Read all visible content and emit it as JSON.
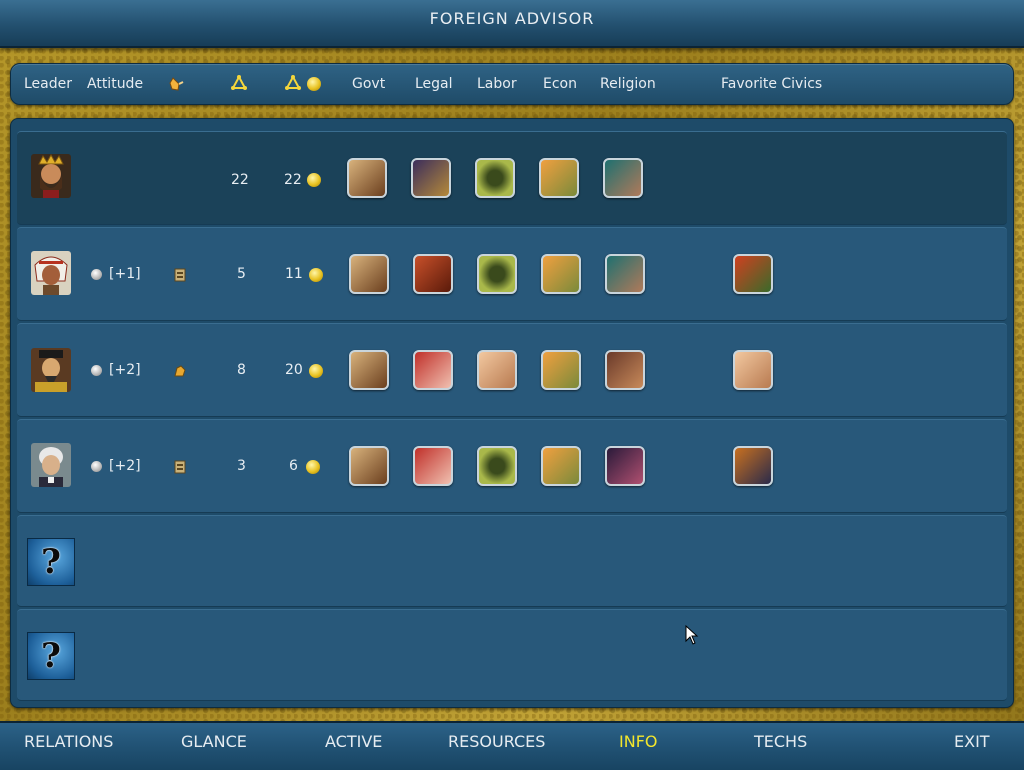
{
  "title": "FOREIGN ADVISOR",
  "headers": {
    "leader": "Leader",
    "attitude": "Attitude",
    "trade_icon": "trade-gesture-icon",
    "trade_routes_icon": "trade-routes-icon",
    "gold_icon": "gold-coin-icon",
    "govt": "Govt",
    "legal": "Legal",
    "labor": "Labor",
    "econ": "Econ",
    "religion": "Religion",
    "favorite_civics": "Favorite Civics"
  },
  "rows": [
    {
      "portrait": "king-crowned-leader-portrait",
      "attitude_modifier": "",
      "trade": "22",
      "trade_gold": "22",
      "civics": [
        "hereditary-rule",
        "vassalage",
        "slavery",
        "decentralization",
        "paganism"
      ],
      "favorite": ""
    },
    {
      "portrait": "native-chief-leader-portrait",
      "attitude_modifier": "[+1]",
      "trade": "5",
      "trade_gold": "11",
      "civics": [
        "hereditary-rule",
        "bureaucracy",
        "slavery",
        "decentralization",
        "paganism"
      ],
      "favorite": "police-state"
    },
    {
      "portrait": "eastern-emperor-leader-portrait",
      "attitude_modifier": "[+2]",
      "trade": "8",
      "trade_gold": "20",
      "civics": [
        "hereditary-rule",
        "nationhood",
        "caste-system",
        "decentralization",
        "theocracy"
      ],
      "favorite": "caste-system"
    },
    {
      "portrait": "colonial-statesman-leader-portrait",
      "attitude_modifier": "[+2]",
      "trade": "3",
      "trade_gold": "6",
      "civics": [
        "hereditary-rule",
        "nationhood",
        "slavery",
        "decentralization",
        "organized-religion"
      ],
      "favorite": "free-speech"
    }
  ],
  "unknown_rows": [
    {
      "glyph": "?"
    },
    {
      "glyph": "?"
    }
  ],
  "nav": [
    {
      "label": "RELATIONS",
      "active": false
    },
    {
      "label": "GLANCE",
      "active": false
    },
    {
      "label": "ACTIVE",
      "active": false
    },
    {
      "label": "RESOURCES",
      "active": false
    },
    {
      "label": "INFO",
      "active": true
    },
    {
      "label": "TECHS",
      "active": false
    },
    {
      "label": "EXIT",
      "active": false
    }
  ],
  "colors": {
    "active_nav": "#f3e62c",
    "panel_blue": "#28587a",
    "frame_gold": "#b6982a"
  }
}
